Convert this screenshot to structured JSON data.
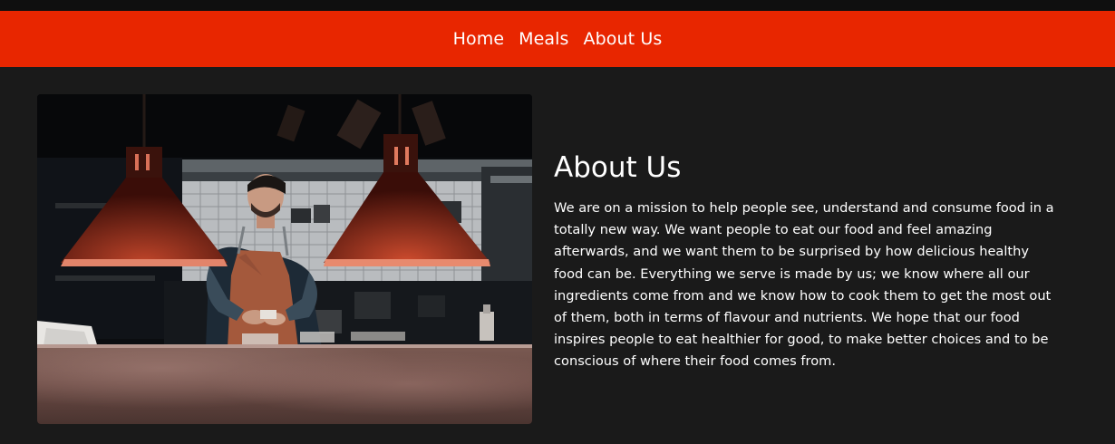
{
  "nav": {
    "items": [
      {
        "label": "Home"
      },
      {
        "label": "Meals"
      },
      {
        "label": "About Us"
      }
    ],
    "background_color": "#e82600"
  },
  "page": {
    "background_color": "#1a1a1a"
  },
  "about": {
    "image_icon": "chef-kitchen-photo",
    "title": "About Us",
    "body": "We are on a mission to help people see, understand and consume food in a totally new way. We want people to eat our food and feel amazing afterwards, and we want them to be surprised by how delicious healthy food can be. Everything we serve is made by us; we know where all our ingredients come from and we know how to cook them to get the most out of them, both in terms of flavour and nutrients. We hope that our food inspires people to eat healthier for good, to make better choices and to be conscious of where their food comes from."
  }
}
